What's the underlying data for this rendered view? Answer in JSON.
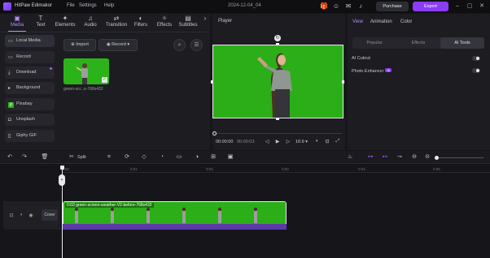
{
  "app": {
    "name": "HitPaw Edimakor",
    "date": "2024-12-04_04"
  },
  "menu": [
    "File",
    "Settings",
    "Help"
  ],
  "title_actions": {
    "purchase": "Purchase",
    "export": "Export"
  },
  "tools": {
    "tabs": [
      {
        "label": "Media",
        "icon": "media-icon"
      },
      {
        "label": "Text",
        "icon": "text-icon"
      },
      {
        "label": "Elements",
        "icon": "elements-icon"
      },
      {
        "label": "Audio",
        "icon": "audio-icon"
      },
      {
        "label": "Transition",
        "icon": "transition-icon"
      },
      {
        "label": "Filters",
        "icon": "filters-icon"
      },
      {
        "label": "Effects",
        "icon": "effects-icon"
      },
      {
        "label": "Subtitles",
        "icon": "subtitles-icon"
      }
    ],
    "active_tab": "Media"
  },
  "sidebar": {
    "items": [
      {
        "label": "Local Media"
      },
      {
        "label": "Record"
      },
      {
        "label": "Download"
      },
      {
        "label": "Background"
      },
      {
        "label": "Pixabay"
      },
      {
        "label": "Unsplash"
      },
      {
        "label": "Giphy GIF"
      }
    ]
  },
  "media": {
    "import_label": "Import",
    "record_label": "Record",
    "thumb_label": "green-scr...e-768x432"
  },
  "player": {
    "title": "Player",
    "time_current": "00:00:00",
    "time_total": "00:00:03",
    "ratio": "16:9"
  },
  "right_panel": {
    "tabs": [
      "View",
      "Animation",
      "Color"
    ],
    "active_tab": "View",
    "segments": [
      "Popular",
      "Effects",
      "AI Tools"
    ],
    "active_segment": "AI Tools",
    "options": [
      {
        "label": "AI Cutout",
        "enabled": false
      },
      {
        "label": "Photo Enhancer",
        "badge": "AI",
        "enabled": false
      }
    ]
  },
  "timeline": {
    "split_label": "Split",
    "ruler_ticks": [
      "0:00",
      "0:01",
      "0:02",
      "0:03",
      "0:04",
      "0:05"
    ],
    "cover_label": "Cover",
    "clip_label": "0:03 green-screen-weather-V2-before-768x432"
  },
  "colors": {
    "accent": "#8b3cf5",
    "green_screen": "#2cae18",
    "audio": "#5b3aa8"
  }
}
